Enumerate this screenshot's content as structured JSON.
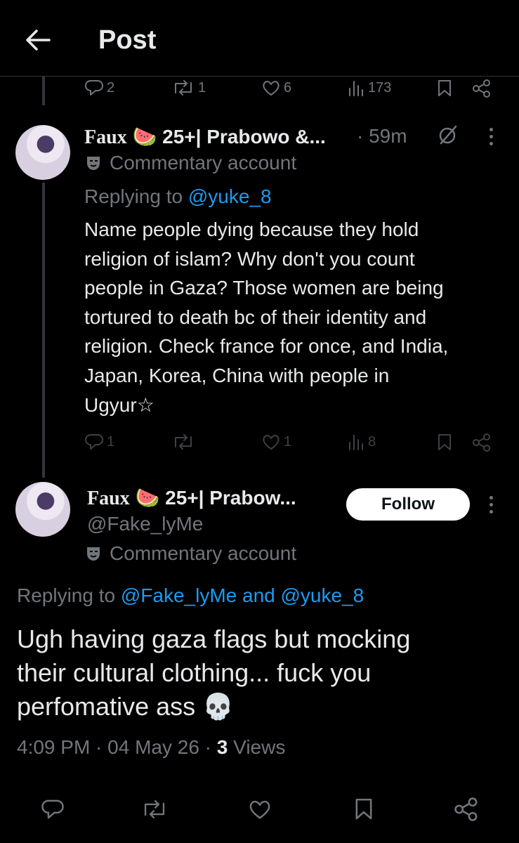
{
  "header": {
    "title": "Post"
  },
  "reply_actions": {
    "replies": "2",
    "reposts": "1",
    "likes": "6",
    "views": "173"
  },
  "reply_tweet": {
    "name": "Faux",
    "name_emoji": "🍉",
    "name_rest": "25+| Prabowo &...",
    "time": "· 59m",
    "badge": "Commentary account",
    "replying_prefix": "Replying to ",
    "replying_handle": "@yuke_8",
    "text_lines": [
      "Name people dying because they hold",
      "religion of islam? Why don't you count",
      "people in Gaza? Those women are being",
      "tortured to death bc of their identity and",
      "religion. Check france for once, and India,",
      "Japan, Korea, China with people in",
      "Ugyur☆"
    ],
    "replies": "1",
    "likes": "1",
    "views": "8"
  },
  "main_tweet": {
    "name": "Faux",
    "name_emoji": "🍉",
    "name_rest": "25+| Prabow...",
    "handle": "@Fake_lyMe",
    "badge": "Commentary account",
    "follow_label": "Follow",
    "replying_prefix": "Replying to ",
    "replying_handles": "@Fake_lyMe and @yuke_8",
    "text_lines": [
      "Ugh having gaza flags but mocking",
      "their cultural clothing... fuck you",
      "perfomative ass 💀"
    ],
    "time": "4:09 PM · 04 May 26 · ",
    "views_count": "3",
    "views_label": " Views"
  },
  "colors": {
    "background": "#000000",
    "text": "#e7e9ea",
    "muted": "#71767b",
    "link": "#1d9bf0"
  }
}
